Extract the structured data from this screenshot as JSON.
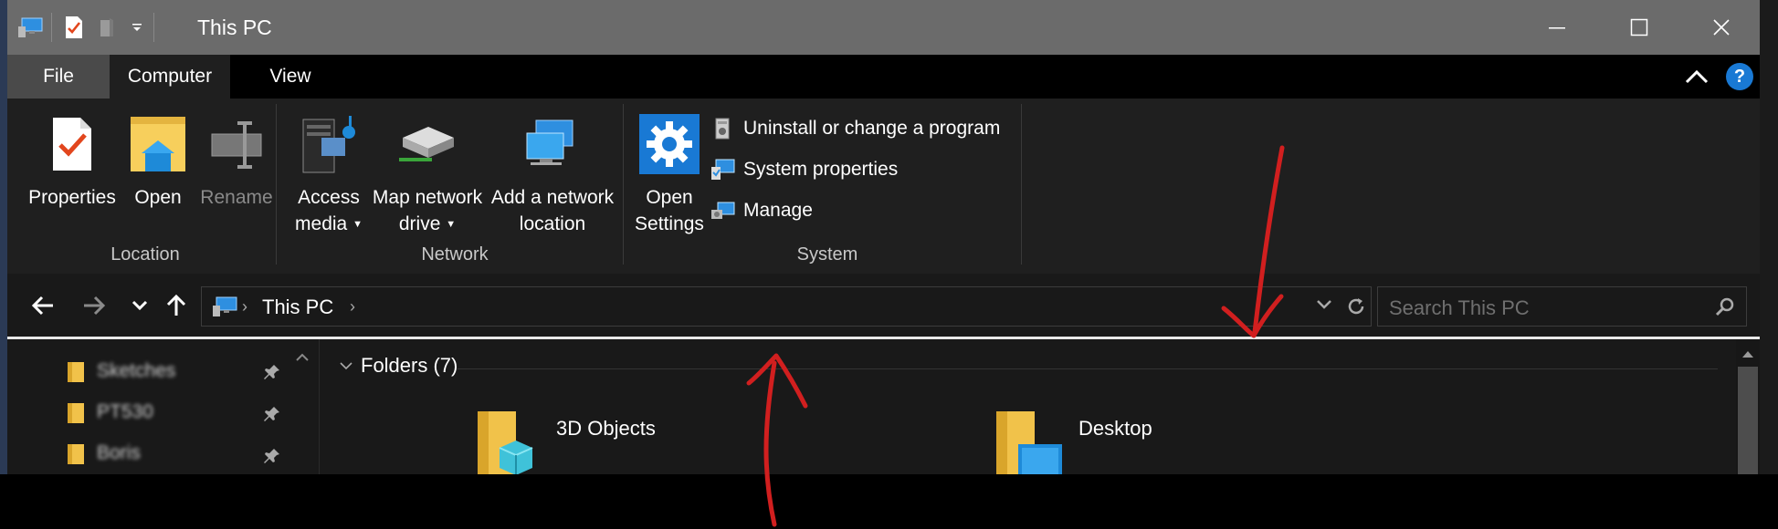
{
  "window": {
    "title": "This PC"
  },
  "ribbon": {
    "tabs": [
      {
        "label": "File"
      },
      {
        "label": "Computer"
      },
      {
        "label": "View"
      }
    ],
    "help_label": "?",
    "location_group": {
      "label": "Location",
      "buttons": [
        {
          "label": "Properties",
          "icon": "properties-icon"
        },
        {
          "label": "Open",
          "icon": "open-folder-icon"
        },
        {
          "label": "Rename",
          "icon": "rename-icon",
          "disabled": true
        }
      ]
    },
    "network_group": {
      "label": "Network",
      "buttons": [
        {
          "line1": "Access",
          "line2": "media",
          "icon": "access-media-icon",
          "dropdown": true
        },
        {
          "line1": "Map network",
          "line2": "drive",
          "icon": "map-network-drive-icon",
          "dropdown": true
        },
        {
          "line1": "Add a network",
          "line2": "location",
          "icon": "add-network-location-icon"
        }
      ]
    },
    "system_group": {
      "label": "System",
      "open_settings": {
        "line1": "Open",
        "line2": "Settings",
        "icon": "settings-gear-icon"
      },
      "items": [
        {
          "label": "Uninstall or change a program",
          "icon": "uninstall-program-icon"
        },
        {
          "label": "System properties",
          "icon": "system-properties-icon"
        },
        {
          "label": "Manage",
          "icon": "manage-computer-icon"
        }
      ]
    }
  },
  "address_bar": {
    "path": "This PC",
    "search_placeholder": "Search This PC"
  },
  "nav_pane": {
    "items": [
      {
        "label": "Sketches",
        "pinned": true
      },
      {
        "label": "PT530",
        "pinned": true
      },
      {
        "label": "Boris",
        "pinned": true
      }
    ]
  },
  "content": {
    "group_title": "Folders (7)",
    "folders": [
      {
        "name": "3D Objects",
        "icon": "3d-objects-folder-icon"
      },
      {
        "name": "Desktop",
        "icon": "desktop-folder-icon"
      }
    ]
  },
  "colors": {
    "titlebar": "#6b6b6b",
    "ribbon": "#1f1f1f",
    "background": "#191919",
    "accent": "#1979d4",
    "annotation": "#d11f1f"
  }
}
